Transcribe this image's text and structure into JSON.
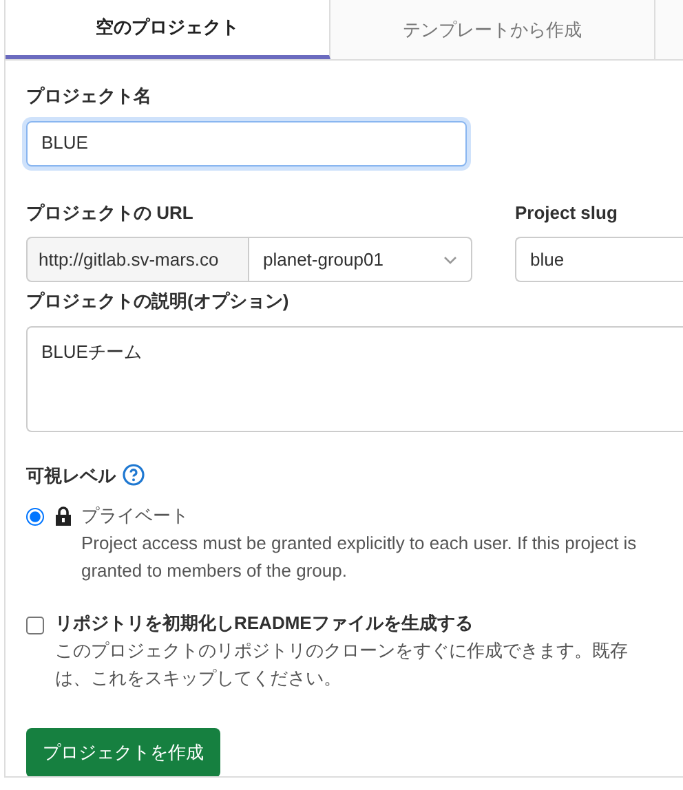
{
  "tabs": [
    {
      "label": "空のプロジェクト",
      "selected": true
    },
    {
      "label": "テンプレートから作成",
      "selected": false
    }
  ],
  "project_name": {
    "label": "プロジェクト名",
    "value": "BLUE"
  },
  "project_url": {
    "label": "プロジェクトの URL",
    "prefix": "http://gitlab.sv-mars.co",
    "namespace": "planet-group01"
  },
  "project_slug": {
    "label": "Project slug",
    "value": "blue"
  },
  "description": {
    "label": "プロジェクトの説明(オプション)",
    "value": "BLUEチーム"
  },
  "visibility": {
    "label": "可視レベル",
    "options": [
      {
        "label": "プライベート",
        "selected": true,
        "lines": [
          "Project access must be granted explicitly to each user. If this project is",
          "granted to members of the group."
        ]
      }
    ]
  },
  "readme": {
    "label": "リポジトリを初期化しREADMEファイルを生成する",
    "checked": false,
    "lines": [
      "このプロジェクトのリポジトリのクローンをすぐに作成できます。既存",
      "は、これをスキップしてください。"
    ]
  },
  "submit": "プロジェクトを作成"
}
